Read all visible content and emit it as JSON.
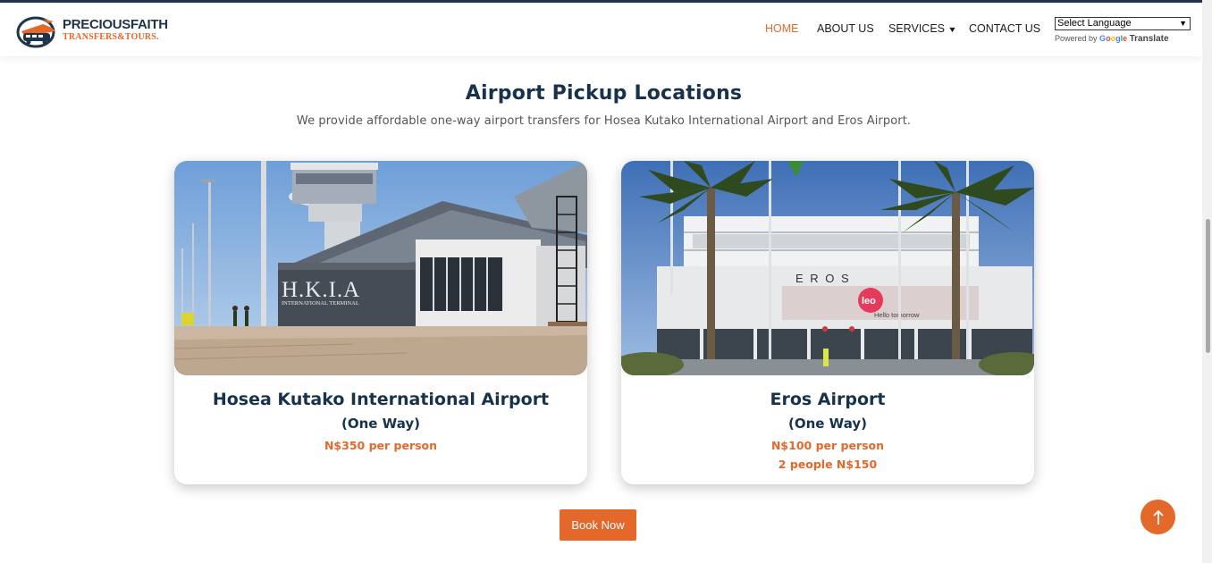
{
  "brand": {
    "name_line1": "PRECIOUSFAITH",
    "name_line2": "TRANSFERS&TOURS.",
    "primary_color": "#1f3349",
    "accent_color": "#e4682a"
  },
  "nav": {
    "items": [
      {
        "label": "HOME",
        "active": true
      },
      {
        "label": "ABOUT US",
        "active": false
      },
      {
        "label": "SERVICES",
        "active": false,
        "has_dropdown": true
      },
      {
        "label": "CONTACT US",
        "active": false
      }
    ]
  },
  "translate": {
    "selected": "Select Language",
    "powered_by": "Powered by",
    "google": "Google",
    "translate_label": "Translate"
  },
  "section": {
    "title": "Airport Pickup Locations",
    "subtitle": "We provide affordable one-way airport transfers for Hosea Kutako International Airport and Eros Airport."
  },
  "cards": [
    {
      "title": "Hosea Kutako International Airport",
      "subtitle": "(One Way)",
      "prices": [
        "N$350 per person"
      ],
      "image_sign_main": "H.K.I.A",
      "image_sign_sub": "INTERNATIONAL TERMINAL"
    },
    {
      "title": "Eros Airport",
      "subtitle": "(One Way)",
      "prices": [
        "N$100 per person",
        "2 people N$150"
      ],
      "image_sign_main": "E R O S",
      "image_logo": "leo",
      "image_tagline": "Hello tomorrow"
    }
  ],
  "cta": {
    "book_label": "Book Now"
  },
  "icons": {
    "dropdown": "chevron-down-icon",
    "scroll_top": "arrow-up-icon",
    "logo": "shuttle-van-logo"
  }
}
